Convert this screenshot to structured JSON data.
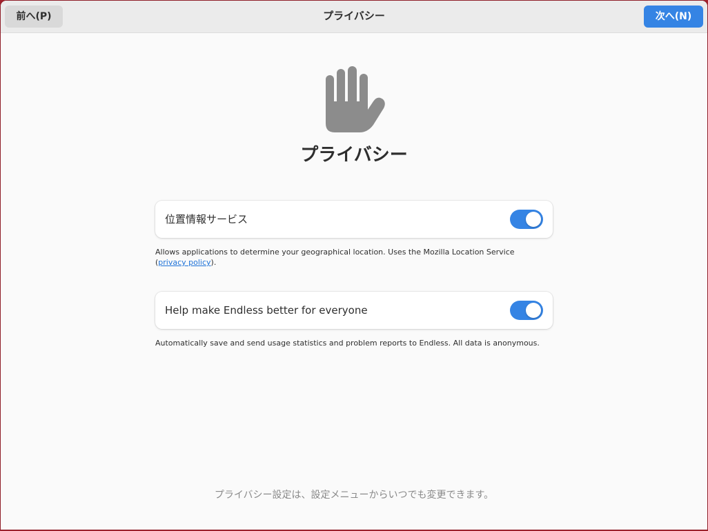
{
  "header": {
    "back_label": "前へ(P)",
    "title": "プライバシー",
    "next_label": "次へ(N)"
  },
  "main": {
    "icon": "raised-hand-icon",
    "heading": "プライバシー",
    "location": {
      "label": "位置情報サービス",
      "enabled": true,
      "description_prefix": "Allows applications to determine your geographical location. Uses the Mozilla Location Service (",
      "link_text": "privacy policy",
      "description_suffix": ")."
    },
    "metrics": {
      "label": "Help make Endless better for everyone",
      "enabled": true,
      "description": "Automatically save and send usage statistics and problem reports to Endless. All data is anonymous."
    },
    "footer_note": "プライバシー設定は、設定メニューからいつでも変更できます。"
  },
  "colors": {
    "accent": "#3584e4",
    "link": "#1c71d8",
    "background": "#fafafa",
    "desktop": "#a3222e"
  }
}
